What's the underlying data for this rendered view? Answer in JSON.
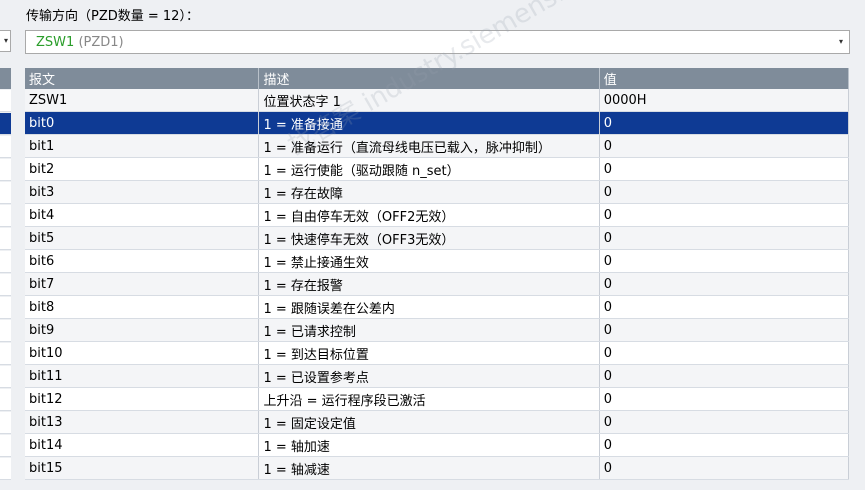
{
  "title": "传输方向（PZD数量 = 12）：",
  "dropdown": {
    "value": "ZSW1",
    "sub": "(PZD1)",
    "arrow": "▾"
  },
  "left_dropdown_arrow": "▾",
  "table": {
    "headers": [
      "报文",
      "描述",
      "值"
    ],
    "rows": [
      [
        "ZSW1",
        "位置状态字 1",
        "0000H"
      ],
      [
        "bit0",
        "1 = 准备接通",
        "0"
      ],
      [
        "bit1",
        "1 = 准备运行（直流母线电压已载入，脉冲抑制）",
        "0"
      ],
      [
        "bit2",
        "1 = 运行使能（驱动跟随 n_set）",
        "0"
      ],
      [
        "bit3",
        "1 = 存在故障",
        "0"
      ],
      [
        "bit4",
        "1 = 自由停车无效（OFF2无效）",
        "0"
      ],
      [
        "bit5",
        "1 = 快速停车无效（OFF3无效）",
        "0"
      ],
      [
        "bit6",
        "1 = 禁止接通生效",
        "0"
      ],
      [
        "bit7",
        "1 = 存在报警",
        "0"
      ],
      [
        "bit8",
        "1 = 跟随误差在公差内",
        "0"
      ],
      [
        "bit9",
        "1 = 已请求控制",
        "0"
      ],
      [
        "bit10",
        "1 = 到达目标位置",
        "0"
      ],
      [
        "bit11",
        "1 = 已设置参考点",
        "0"
      ],
      [
        "bit12",
        "上升沿 = 运行程序段已激活",
        "0"
      ],
      [
        "bit13",
        "1 = 固定设定值",
        "0"
      ],
      [
        "bit14",
        "1 = 轴加速",
        "0"
      ],
      [
        "bit15",
        "1 = 轴减速",
        "0"
      ]
    ]
  },
  "watermark": "找答案 industry.siemens.com/cs",
  "colors": {
    "header": "#7f8c9a",
    "selected": "#0e3a94",
    "dropdown_text": "#2a9d2a"
  }
}
